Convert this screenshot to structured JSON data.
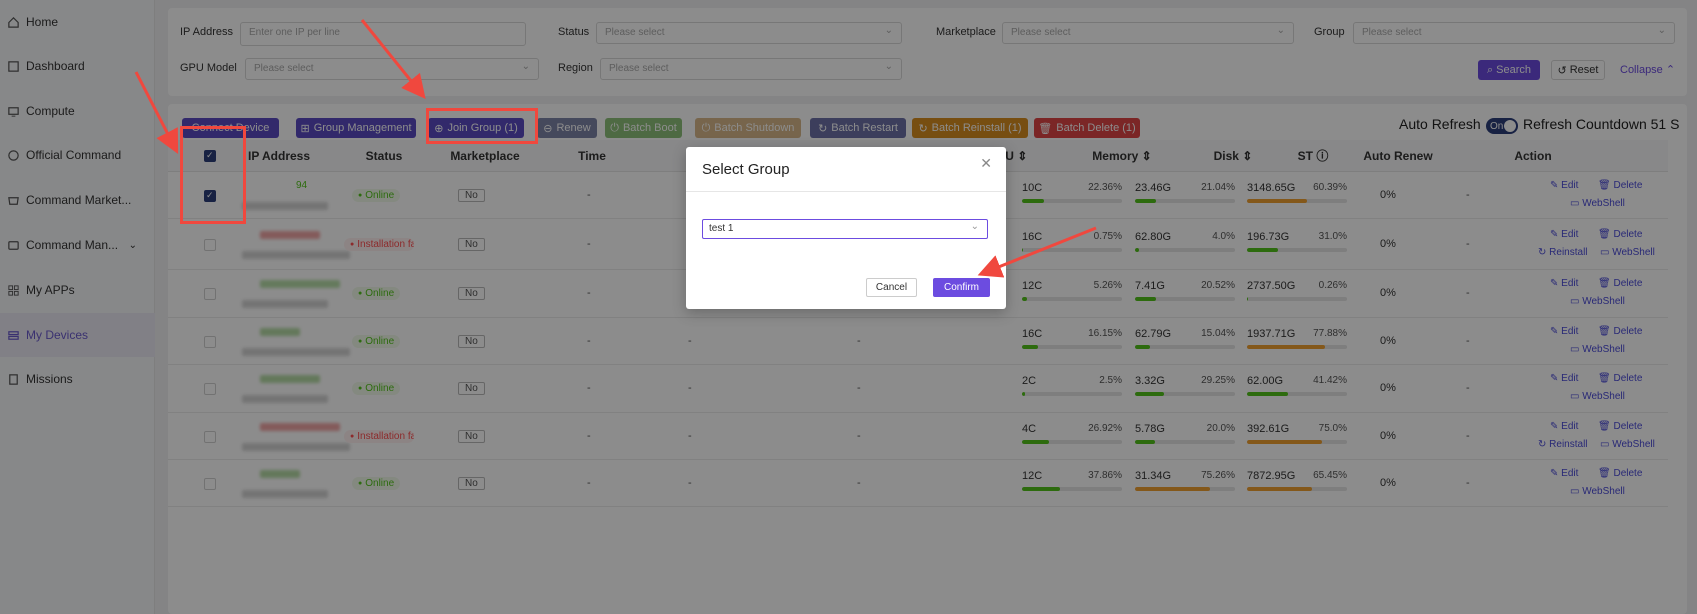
{
  "sidebar": {
    "items": [
      {
        "label": "Home",
        "icon": "home-icon"
      },
      {
        "label": "Dashboard",
        "icon": "dashboard-icon"
      },
      {
        "label": "Compute",
        "icon": "compute-icon"
      },
      {
        "label": "Official Command",
        "icon": "command-icon"
      },
      {
        "label": "Command Market...",
        "icon": "market-icon"
      },
      {
        "label": "Command Man...",
        "icon": "manage-icon"
      },
      {
        "label": "My APPs",
        "icon": "apps-icon"
      },
      {
        "label": "My Devices",
        "icon": "devices-icon"
      },
      {
        "label": "Missions",
        "icon": "missions-icon"
      }
    ]
  },
  "filters": {
    "ip_label": "IP Address",
    "ip_placeholder": "Enter one IP per line",
    "status_label": "Status",
    "status_placeholder": "Please select",
    "marketplace_label": "Marketplace",
    "marketplace_placeholder": "Please select",
    "group_label": "Group",
    "group_placeholder": "Please select",
    "gpu_label": "GPU Model",
    "gpu_placeholder": "Please select",
    "region_label": "Region",
    "region_placeholder": "Please select",
    "search": "Search",
    "reset": "Reset",
    "collapse": "Collapse"
  },
  "toolbar": {
    "connect": "Connect Device",
    "group_mgmt": "Group Management",
    "join_group": "Join Group (1)",
    "renew": "Renew",
    "batch_boot": "Batch Boot",
    "batch_shutdown": "Batch Shutdown",
    "batch_restart": "Batch Restart",
    "batch_reinstall": "Batch Reinstall (1)",
    "batch_delete": "Batch Delete (1)",
    "auto_refresh": "Auto Refresh",
    "toggle": "On",
    "countdown": "Refresh Countdown 51 S"
  },
  "columns": {
    "ip": "IP Address",
    "status": "Status",
    "marketplace": "Marketplace",
    "time": "Time",
    "cpu": "CPU",
    "memory": "Memory",
    "disk": "Disk",
    "st": "ST",
    "auto_renew": "Auto Renew",
    "action": "Action"
  },
  "rows": [
    {
      "ip": "94",
      "status": "Online",
      "status_kind": "online",
      "market": "No",
      "time": "-",
      "cpu": "10C",
      "cpu_pct": "22.36%",
      "cpu_v": 22.36,
      "mem": "23.46G",
      "mem_pct": "21.04%",
      "mem_v": 21.04,
      "disk": "3148.65G",
      "disk_pct": "60.39%",
      "disk_v": 60.39,
      "st": "0%",
      "auto_renew": "-",
      "checked": true,
      "reinstall": false
    },
    {
      "ip": "",
      "status": "Installation failed",
      "status_kind": "install",
      "market": "No",
      "time": "-",
      "cpu": "16C",
      "cpu_pct": "0.75%",
      "cpu_v": 0.75,
      "mem": "62.80G",
      "mem_pct": "4.0%",
      "mem_v": 4.0,
      "disk": "196.73G",
      "disk_pct": "31.0%",
      "disk_v": 31.0,
      "st": "0%",
      "auto_renew": "-",
      "checked": false,
      "reinstall": true
    },
    {
      "ip": "",
      "status": "Online",
      "status_kind": "online",
      "market": "No",
      "time": "-",
      "cpu": "12C",
      "cpu_pct": "5.26%",
      "cpu_v": 5.26,
      "mem": "7.41G",
      "mem_pct": "20.52%",
      "mem_v": 20.52,
      "disk": "2737.50G",
      "disk_pct": "0.26%",
      "disk_v": 0.26,
      "st": "0%",
      "auto_renew": "-",
      "checked": false,
      "reinstall": false
    },
    {
      "ip": "",
      "status": "Online",
      "status_kind": "online",
      "market": "No",
      "time": "-",
      "cpu": "16C",
      "cpu_pct": "16.15%",
      "cpu_v": 16.15,
      "mem": "62.79G",
      "mem_pct": "15.04%",
      "mem_v": 15.04,
      "disk": "1937.71G",
      "disk_pct": "77.88%",
      "disk_v": 77.88,
      "st": "0%",
      "auto_renew": "-",
      "checked": false,
      "reinstall": false
    },
    {
      "ip": "",
      "status": "Online",
      "status_kind": "online",
      "market": "No",
      "time": "-",
      "cpu": "2C",
      "cpu_pct": "2.5%",
      "cpu_v": 2.5,
      "mem": "3.32G",
      "mem_pct": "29.25%",
      "mem_v": 29.25,
      "disk": "62.00G",
      "disk_pct": "41.42%",
      "disk_v": 41.42,
      "st": "0%",
      "auto_renew": "-",
      "checked": false,
      "reinstall": false
    },
    {
      "ip": "",
      "status": "Installation failed",
      "status_kind": "install",
      "market": "No",
      "time": "-",
      "cpu": "4C",
      "cpu_pct": "26.92%",
      "cpu_v": 26.92,
      "mem": "5.78G",
      "mem_pct": "20.0%",
      "mem_v": 20.0,
      "disk": "392.61G",
      "disk_pct": "75.0%",
      "disk_v": 75.0,
      "st": "0%",
      "auto_renew": "-",
      "checked": false,
      "reinstall": true
    },
    {
      "ip": "",
      "status": "Online",
      "status_kind": "online",
      "market": "No",
      "time": "-",
      "cpu": "12C",
      "cpu_pct": "37.86%",
      "cpu_v": 37.86,
      "mem": "31.34G",
      "mem_pct": "75.26%",
      "mem_v": 75.26,
      "disk": "7872.95G",
      "disk_pct": "65.45%",
      "disk_v": 65.45,
      "st": "0%",
      "auto_renew": "-",
      "checked": false,
      "reinstall": false
    }
  ],
  "actions": {
    "edit": "Edit",
    "delete": "Delete",
    "webshell": "WebShell",
    "reinstall": "Reinstall"
  },
  "modal": {
    "title": "Select Group",
    "selected": "test 1",
    "cancel": "Cancel",
    "confirm": "Confirm"
  },
  "colors": {
    "accent": "#6c4ce0",
    "online": "#52c41a",
    "danger": "#ff4d4f",
    "bar_green": "#52c41a",
    "bar_orange": "#f0a030"
  }
}
